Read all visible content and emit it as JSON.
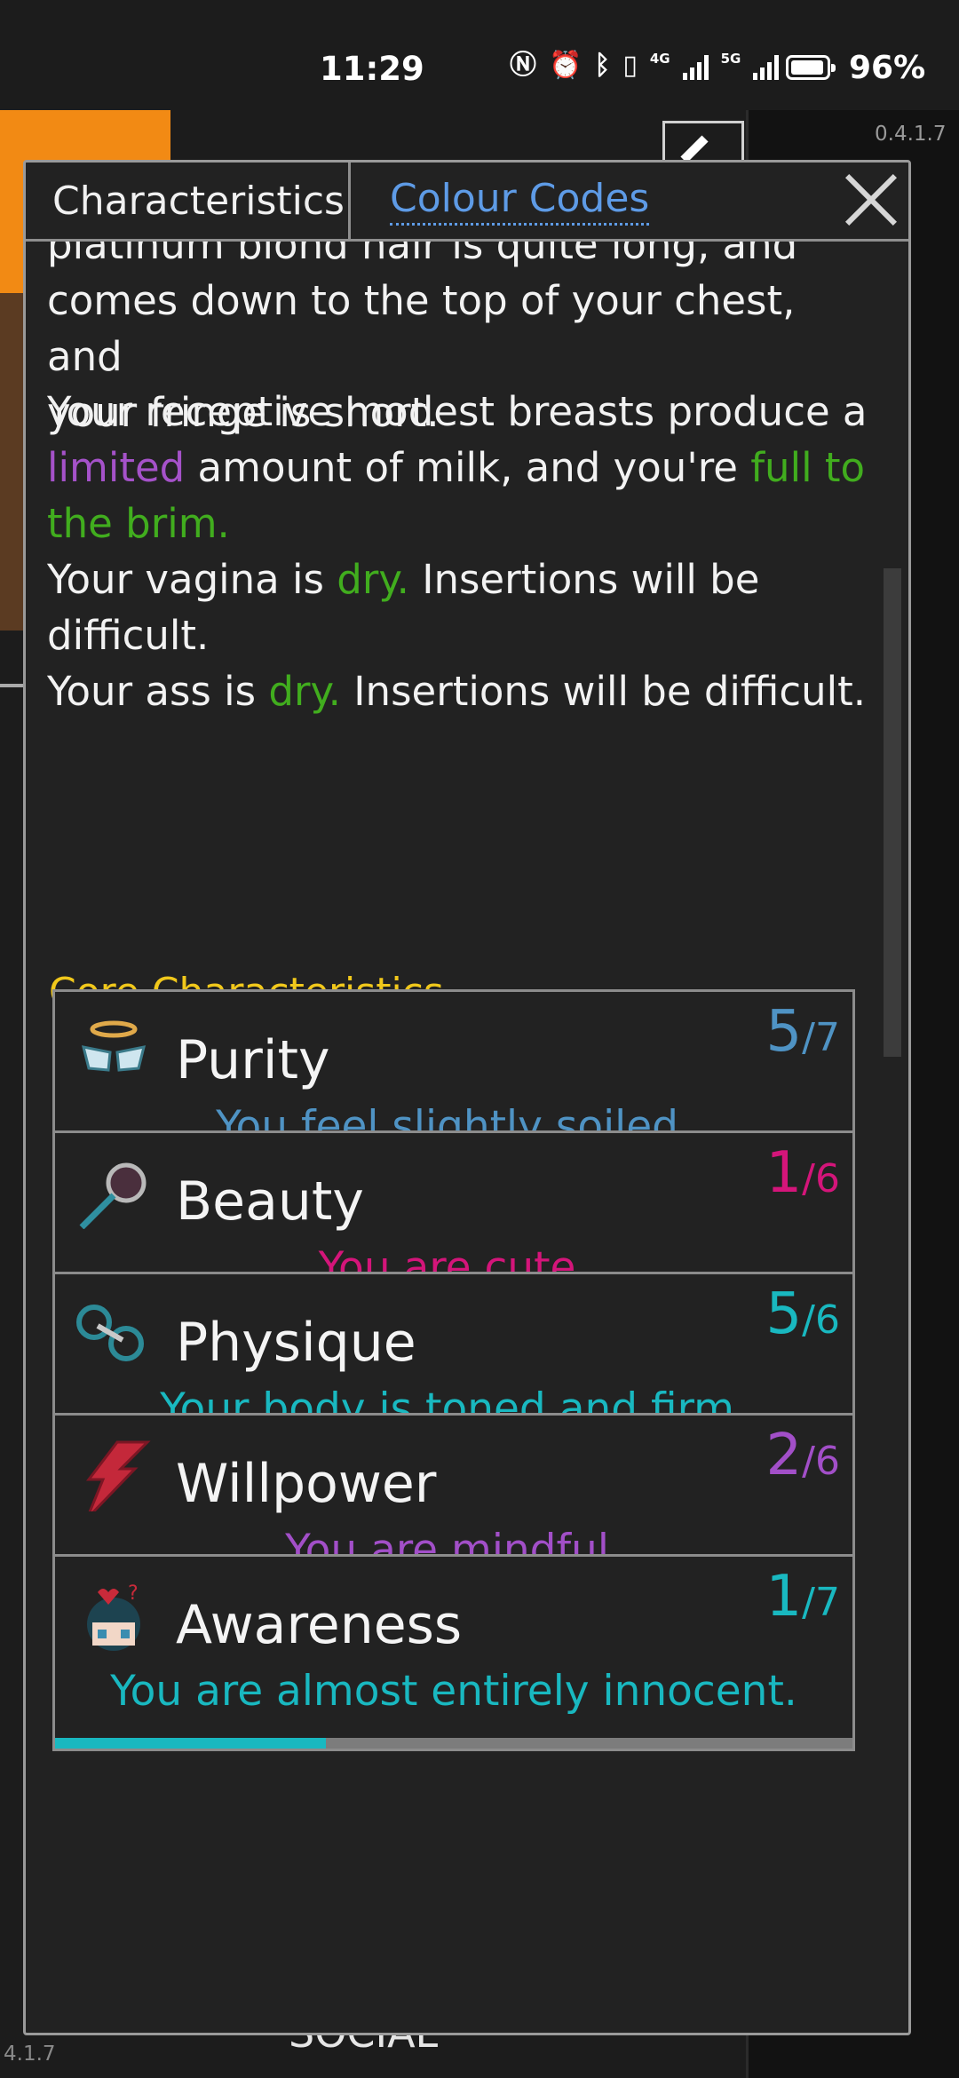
{
  "status_bar": {
    "time": "11:29",
    "icons": [
      "nfc-icon",
      "alarm-icon",
      "bluetooth-icon",
      "vibrate-icon",
      "signal-4g-icon",
      "signal-5g-icon"
    ],
    "net1": "4G",
    "net2": "5G",
    "battery_level": 0.96,
    "battery_pct": "96%"
  },
  "background": {
    "version_top": "0.4.1.7",
    "version_bottom": "4.1.7",
    "social_label": "SOCIAL"
  },
  "dialog": {
    "tabs": [
      {
        "label": "Characteristics",
        "active": true
      },
      {
        "label": "Colour Codes",
        "active": false
      }
    ],
    "close_icon": "close-icon",
    "description": {
      "hair_line1": "platinum blond hair is quite long, and",
      "hair_line2": "comes down to the top of your chest, and",
      "hair_line3": "your fringe is short.",
      "breasts_pre": "Your receptive modest breasts produce a",
      "breasts_limited": "limited",
      "breasts_mid": " amount of milk, and you're ",
      "breasts_full1": "full to",
      "breasts_full2": "the brim.",
      "vagina_pre": "Your vagina is ",
      "vagina_dry": "dry.",
      "vagina_post1": " Insertions will be",
      "vagina_post2": "difficult.",
      "ass_pre": "Your ass is ",
      "ass_dry": "dry.",
      "ass_post": " Insertions will be difficult."
    },
    "colors": {
      "purple": "#a552c9",
      "green": "#41ad1e",
      "section_title": "#f1c81b",
      "tab_link": "#5e9be6"
    },
    "section_title": "Core Characteristics",
    "characteristics": [
      {
        "name": "Purity",
        "value": "5",
        "max": "/7",
        "description": "You feel slightly soiled.",
        "color": "#4f93c4",
        "fill": 0.49,
        "icon": "halo-wings-icon"
      },
      {
        "name": "Beauty",
        "value": "1",
        "max": "/6",
        "description": "You are cute.",
        "color": "#d4157a",
        "fill": 0.27,
        "icon": "hand-mirror-icon"
      },
      {
        "name": "Physique",
        "value": "5",
        "max": "/6",
        "description": "Your body is toned and firm.",
        "color": "#19b8c0",
        "fill": 0.31,
        "icon": "dumbbell-icon"
      },
      {
        "name": "Willpower",
        "value": "2",
        "max": "/6",
        "description": "You are mindful.",
        "color": "#a24fc8",
        "fill": 0.66,
        "icon": "lightning-bolt-icon"
      },
      {
        "name": "Awareness",
        "value": "1",
        "max": "/7",
        "description": "You are almost entirely innocent.",
        "color": "#19b8c0",
        "fill": 0.34,
        "icon": "innocent-girl-icon"
      }
    ]
  }
}
